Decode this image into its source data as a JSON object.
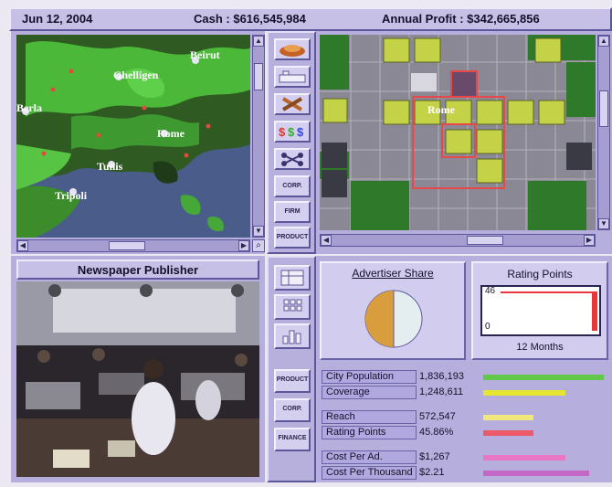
{
  "status": {
    "date": "Jun 12, 2004",
    "cash": "Cash : $616,545,984",
    "profit": "Annual Profit : $342,665,856"
  },
  "map": {
    "cities": [
      "Beirut",
      "Ghelligen",
      "Berla",
      "Rome",
      "Tunis",
      "Tripoli"
    ]
  },
  "toolbar_top": {
    "buttons": [
      "food-icon",
      "factory-icon",
      "tools-icon",
      "money-icon",
      "links-icon"
    ],
    "text_buttons": [
      "CORP.",
      "FIRM",
      "PRODUCT"
    ]
  },
  "city_view": {
    "label": "Rome"
  },
  "publisher": {
    "title": "Newspaper Publisher"
  },
  "toolbar_bottom": {
    "icons": [
      "grid-icon",
      "table-icon",
      "bar-chart-icon"
    ],
    "text_buttons": [
      "PRODUCT",
      "CORP.",
      "FINANCE"
    ]
  },
  "advertiser": {
    "title": "Advertiser Share"
  },
  "chart_data": {
    "type": "line",
    "title": "Rating Points",
    "xlabel": "12 Months",
    "y_top_label": "46",
    "y_bottom_label": "0",
    "ylim": [
      0,
      46
    ],
    "series": [
      {
        "values": [
          46,
          46,
          46,
          46,
          46,
          46,
          46,
          46,
          46,
          46,
          46,
          46
        ]
      }
    ],
    "bar_color": "#e8363a"
  },
  "stats": [
    {
      "label": "City Population",
      "value": "1,836,193",
      "fill": 1.0,
      "color": "#62c84a"
    },
    {
      "label": "Coverage",
      "value": "1,248,611",
      "fill": 0.68,
      "color": "#e6e632"
    },
    {
      "label": "Reach",
      "value": "572,547",
      "fill": 0.42,
      "color": "#f0e87c"
    },
    {
      "label": "Rating Points",
      "value": "45.86%",
      "fill": 0.42,
      "color": "#ec5a6a"
    },
    {
      "label": "Cost Per Ad.",
      "value": "$1,267",
      "fill": 0.68,
      "color": "#e878c4"
    },
    {
      "label": "Cost Per Thousand",
      "value": "$2.21",
      "fill": 0.88,
      "color": "#c468c8"
    }
  ]
}
